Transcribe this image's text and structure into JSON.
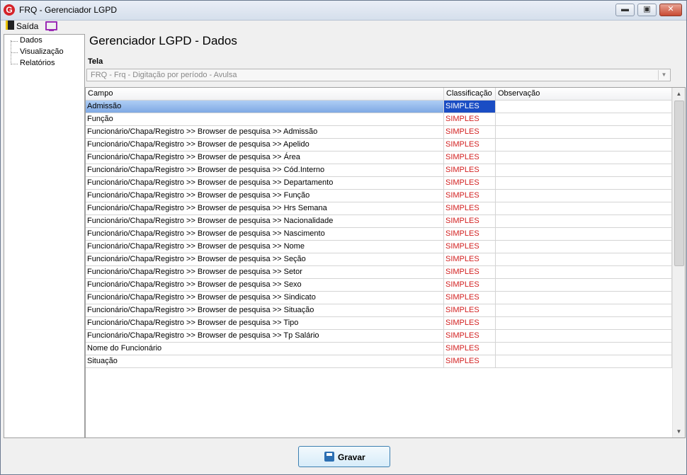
{
  "window": {
    "title": "FRQ - Gerenciador LGPD",
    "icon_letter": "G",
    "minimize": "▬",
    "maximize": "▣",
    "close": "✕"
  },
  "menubar": {
    "saida": "Saída",
    "monitor_icon": "monitor-icon"
  },
  "sidebar": {
    "items": [
      "Dados",
      "Visualização",
      "Relatórios"
    ]
  },
  "page_title": "Gerenciador LGPD - Dados",
  "tela": {
    "label": "Tela",
    "value": "FRQ - Frq - Digitação por período - Avulsa",
    "arrow": "▼"
  },
  "grid": {
    "columns": [
      "Campo",
      "Classificação",
      "Observação"
    ],
    "rows": [
      {
        "campo": "Admissão",
        "classificacao": "SIMPLES",
        "observacao": ""
      },
      {
        "campo": "Função",
        "classificacao": "SIMPLES",
        "observacao": ""
      },
      {
        "campo": "Funcionário/Chapa/Registro >> Browser de pesquisa >> Admissão",
        "classificacao": "SIMPLES",
        "observacao": ""
      },
      {
        "campo": "Funcionário/Chapa/Registro >> Browser de pesquisa >> Apelido",
        "classificacao": "SIMPLES",
        "observacao": ""
      },
      {
        "campo": "Funcionário/Chapa/Registro >> Browser de pesquisa >> Área",
        "classificacao": "SIMPLES",
        "observacao": ""
      },
      {
        "campo": "Funcionário/Chapa/Registro >> Browser de pesquisa >> Cód.Interno",
        "classificacao": "SIMPLES",
        "observacao": ""
      },
      {
        "campo": "Funcionário/Chapa/Registro >> Browser de pesquisa >> Departamento",
        "classificacao": "SIMPLES",
        "observacao": ""
      },
      {
        "campo": "Funcionário/Chapa/Registro >> Browser de pesquisa >> Função",
        "classificacao": "SIMPLES",
        "observacao": ""
      },
      {
        "campo": "Funcionário/Chapa/Registro >> Browser de pesquisa >> Hrs Semana",
        "classificacao": "SIMPLES",
        "observacao": ""
      },
      {
        "campo": "Funcionário/Chapa/Registro >> Browser de pesquisa >> Nacionalidade",
        "classificacao": "SIMPLES",
        "observacao": ""
      },
      {
        "campo": "Funcionário/Chapa/Registro >> Browser de pesquisa >> Nascimento",
        "classificacao": "SIMPLES",
        "observacao": ""
      },
      {
        "campo": "Funcionário/Chapa/Registro >> Browser de pesquisa >> Nome",
        "classificacao": "SIMPLES",
        "observacao": ""
      },
      {
        "campo": "Funcionário/Chapa/Registro >> Browser de pesquisa >> Seção",
        "classificacao": "SIMPLES",
        "observacao": ""
      },
      {
        "campo": "Funcionário/Chapa/Registro >> Browser de pesquisa >> Setor",
        "classificacao": "SIMPLES",
        "observacao": ""
      },
      {
        "campo": "Funcionário/Chapa/Registro >> Browser de pesquisa >> Sexo",
        "classificacao": "SIMPLES",
        "observacao": ""
      },
      {
        "campo": "Funcionário/Chapa/Registro >> Browser de pesquisa >> Sindicato",
        "classificacao": "SIMPLES",
        "observacao": ""
      },
      {
        "campo": "Funcionário/Chapa/Registro >> Browser de pesquisa >> Situação",
        "classificacao": "SIMPLES",
        "observacao": ""
      },
      {
        "campo": "Funcionário/Chapa/Registro >> Browser de pesquisa >> Tipo",
        "classificacao": "SIMPLES",
        "observacao": ""
      },
      {
        "campo": "Funcionário/Chapa/Registro >> Browser de pesquisa >> Tp Salário",
        "classificacao": "SIMPLES",
        "observacao": ""
      },
      {
        "campo": "Nome do Funcionário",
        "classificacao": "SIMPLES",
        "observacao": ""
      },
      {
        "campo": "Situação",
        "classificacao": "SIMPLES",
        "observacao": ""
      }
    ],
    "selected_row": 0,
    "scroll_up": "▲",
    "scroll_down": "▼"
  },
  "save_button": {
    "label": "Gravar",
    "icon": "save-icon"
  },
  "colors": {
    "classification_text": "#d21f1f",
    "selection": "#1a4dc4"
  }
}
